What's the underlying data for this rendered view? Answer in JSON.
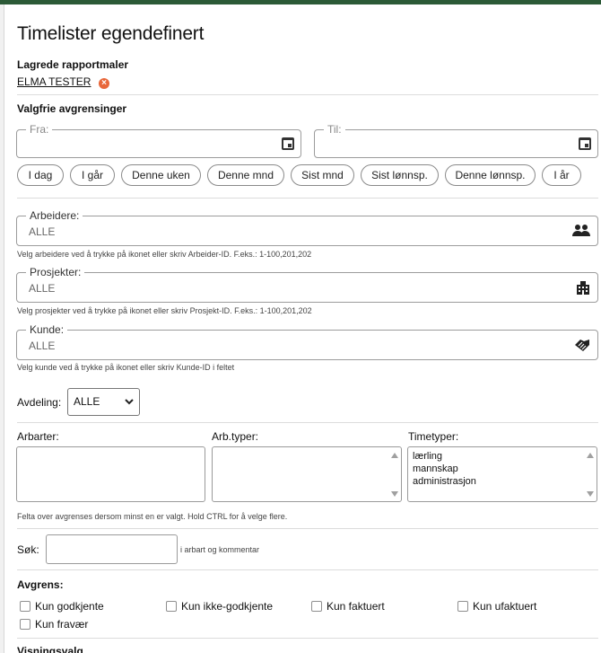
{
  "page": {
    "title": "Timelister egendefinert"
  },
  "saved_templates": {
    "heading": "Lagrede rapportmaler",
    "items": [
      {
        "name": "ELMA TESTER",
        "remove_icon": "remove-circle-icon"
      }
    ]
  },
  "filters": {
    "heading": "Valgfrie avgrensinger",
    "from": {
      "legend": "Fra:",
      "value": "",
      "icon": "calendar-icon"
    },
    "to": {
      "legend": "Til:",
      "value": "",
      "icon": "calendar-icon"
    },
    "quick_ranges": [
      "I dag",
      "I går",
      "Denne uken",
      "Denne mnd",
      "Sist mnd",
      "Sist lønnsp.",
      "Denne lønnsp.",
      "I år"
    ]
  },
  "workers": {
    "legend": "Arbeidere:",
    "value": "ALLE",
    "icon": "people-icon",
    "hint": "Velg arbeidere ved å trykke på ikonet eller skriv Arbeider-ID. F.eks.: 1-100,201,202"
  },
  "projects": {
    "legend": "Prosjekter:",
    "value": "ALLE",
    "icon": "building-icon",
    "hint": "Velg prosjekter ved å trykke på ikonet eller skriv Prosjekt-ID. F.eks.: 1-100,201,202"
  },
  "customer": {
    "legend": "Kunde:",
    "value": "ALLE",
    "icon": "handshake-icon",
    "hint": "Velg kunde ved å trykke på ikonet eller skriv Kunde-ID i feltet"
  },
  "department": {
    "label": "Avdeling:",
    "selected": "ALLE"
  },
  "lists": {
    "work_types": {
      "label": "Arbarter:",
      "options": []
    },
    "worker_types": {
      "label": "Arb.typer:",
      "options": []
    },
    "time_types": {
      "label": "Timetyper:",
      "options": [
        "lærling",
        "mannskap",
        "administrasjon"
      ]
    },
    "hint": "Felta over avgrenses dersom minst en er valgt. Hold CTRL for å velge flere."
  },
  "search": {
    "label": "Søk:",
    "value": "",
    "hint": "i arbart og kommentar"
  },
  "limit": {
    "heading": "Avgrens:",
    "options": [
      "Kun godkjente",
      "Kun ikke-godkjente",
      "Kun faktuert",
      "Kun ufaktuert",
      "Kun fravær"
    ]
  },
  "display": {
    "heading": "Visningsvalg"
  }
}
